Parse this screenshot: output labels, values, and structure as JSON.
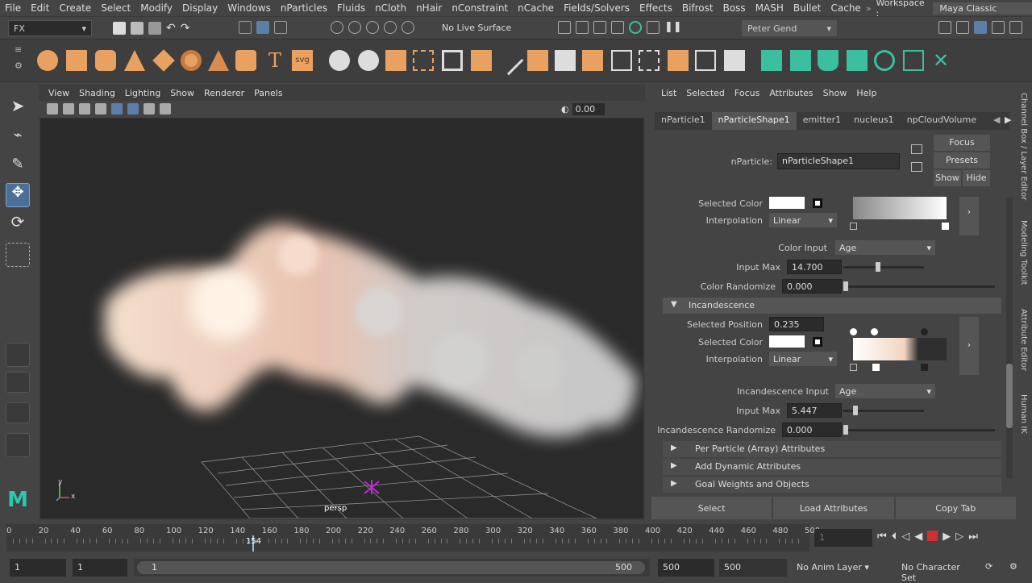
{
  "menubar": {
    "items": [
      "File",
      "Edit",
      "Create",
      "Select",
      "Modify",
      "Display",
      "Windows",
      "nParticles",
      "Fluids",
      "nCloth",
      "nHair",
      "nConstraint",
      "nCache",
      "Fields/Solvers",
      "Effects",
      "Bifrost",
      "Boss",
      "MASH",
      "Bullet",
      "Cache"
    ],
    "workspace_label": "Workspace :",
    "workspace_value": "Maya Classic"
  },
  "statusline": {
    "menuset": "FX",
    "live_surface": "No Live Surface",
    "user": "Peter Gend"
  },
  "viewport": {
    "menus": [
      "View",
      "Shading",
      "Lighting",
      "Show",
      "Renderer",
      "Panels"
    ],
    "gamma": "0.00",
    "camera_label": "persp",
    "axis_y": "y",
    "axis_x": "x"
  },
  "attribute_editor": {
    "menus": [
      "List",
      "Selected",
      "Focus",
      "Attributes",
      "Show",
      "Help"
    ],
    "tabs": [
      "nParticle1",
      "nParticleShape1",
      "emitter1",
      "nucleus1",
      "npCloudVolume"
    ],
    "node_label": "nParticle:",
    "node_value": "nParticleShape1",
    "focus_btn": "Focus",
    "presets_btn": "Presets",
    "show_btn": "Show",
    "hide_btn": "Hide",
    "color": {
      "selected_color_label": "Selected Color",
      "interpolation_label": "Interpolation",
      "interpolation_value": "Linear",
      "color_input_label": "Color Input",
      "color_input_value": "Age",
      "input_max_label": "Input Max",
      "input_max_value": "14.700",
      "input_max_fraction": 0.4,
      "color_randomize_label": "Color Randomize",
      "color_randomize_value": "0.000"
    },
    "incandescence": {
      "section": "Incandescence",
      "selected_position_label": "Selected Position",
      "selected_position_value": "0.235",
      "selected_color_label": "Selected Color",
      "interpolation_label": "Interpolation",
      "interpolation_value": "Linear",
      "input_label": "Incandescence Input",
      "input_value": "Age",
      "input_max_label": "Input Max",
      "input_max_value": "5.447",
      "input_max_fraction": 0.12,
      "randomize_label": "Incandescence Randomize",
      "randomize_value": "0.000"
    },
    "frames": [
      "Per Particle (Array) Attributes",
      "Add Dynamic Attributes",
      "Goal Weights and Objects"
    ],
    "bottom_buttons": [
      "Select",
      "Load Attributes",
      "Copy Tab"
    ]
  },
  "side_tabs": [
    "Channel Box / Layer Editor",
    "Modeling Toolkit",
    "Attribute Editor",
    "Human IK"
  ],
  "timeline": {
    "ticks": [
      "0",
      "20",
      "40",
      "60",
      "80",
      "100",
      "120",
      "140",
      "160",
      "180",
      "200",
      "220",
      "240",
      "260",
      "280",
      "300",
      "320",
      "340",
      "360",
      "380",
      "400",
      "420",
      "440",
      "460",
      "480",
      "500"
    ],
    "current_frame": "154",
    "current_frame_fraction": 0.308,
    "frame_field": "1"
  },
  "range": {
    "start": "1",
    "anim_start": "1",
    "slider_start": "1",
    "slider_end": "500",
    "end": "500",
    "anim_end": "500",
    "anim_layer": "No Anim Layer",
    "char_set": "No Character Set"
  },
  "colors": {
    "accent": "#5b9bd5",
    "shelf_orange": "#e8a160",
    "shelf_teal": "#3bbf9f",
    "record": "#d03030"
  }
}
